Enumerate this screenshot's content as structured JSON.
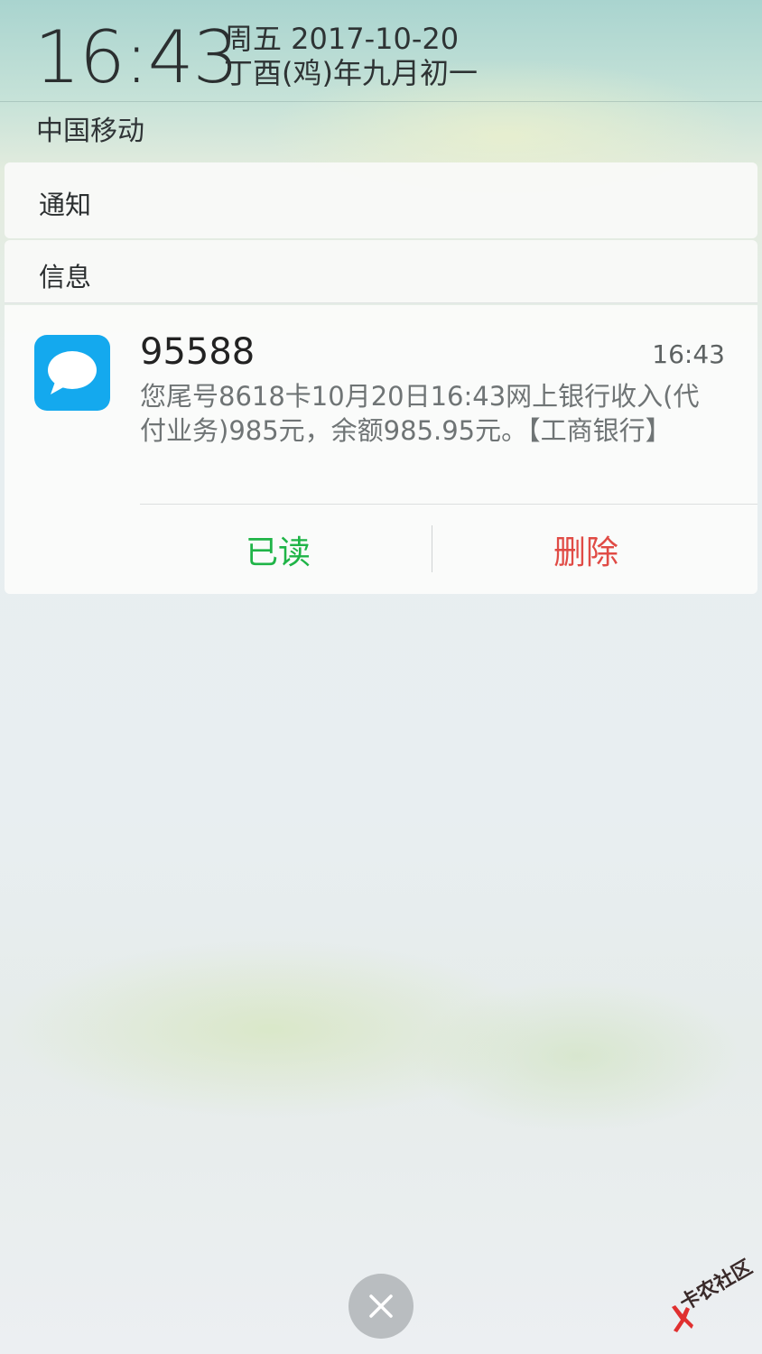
{
  "status": {
    "time": "16:43",
    "date": "周五 2017-10-20",
    "lunar_date": "丁酉(鸡)年九月初一",
    "carrier": "中国移动"
  },
  "sections": {
    "notifications_label": "通知",
    "messages_label": "信息"
  },
  "message": {
    "app_icon": "chat-bubble-icon",
    "sender": "95588",
    "time": "16:43",
    "body": "您尾号8618卡10月20日16:43网上银行收入(代付业务)985元，余额985.95元。【工商银行】",
    "actions": {
      "read_label": "已读",
      "delete_label": "删除"
    }
  },
  "close_icon": "close-icon",
  "watermark": "卡农社区",
  "colors": {
    "app_icon": "#14a9ee",
    "read_action": "#1fb447",
    "delete_action": "#e04b45"
  }
}
